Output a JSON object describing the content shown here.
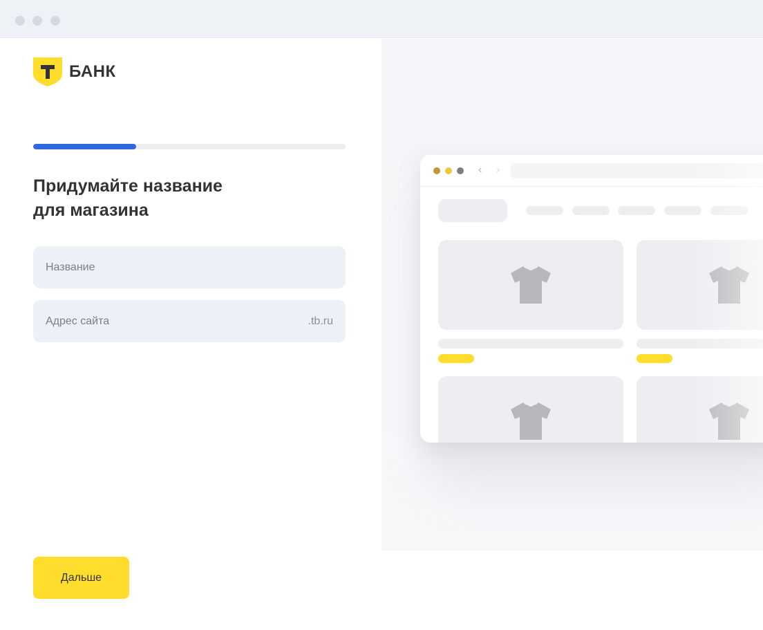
{
  "window": {
    "dots": [
      "#d5dae2",
      "#d5dae2",
      "#d5dae2"
    ]
  },
  "logo": {
    "brand_text": "БАНК",
    "shield_letter": "Т",
    "shield_color": "#ffdd2d"
  },
  "progress": {
    "value_percent": 33,
    "color": "#3068e0"
  },
  "form": {
    "heading_line1": "Придумайте название",
    "heading_line2": "для магазина",
    "name_placeholder": "Название",
    "address_placeholder": "Адрес сайта",
    "address_suffix": ".tb.ru"
  },
  "actions": {
    "next_label": "Дальше",
    "accent_color": "#ffdd2d"
  },
  "preview": {
    "window_dots": [
      "#c4953a",
      "#ecc83a",
      "#7d7f80"
    ],
    "product_icon": "tshirt-icon",
    "product_cards": 4
  }
}
